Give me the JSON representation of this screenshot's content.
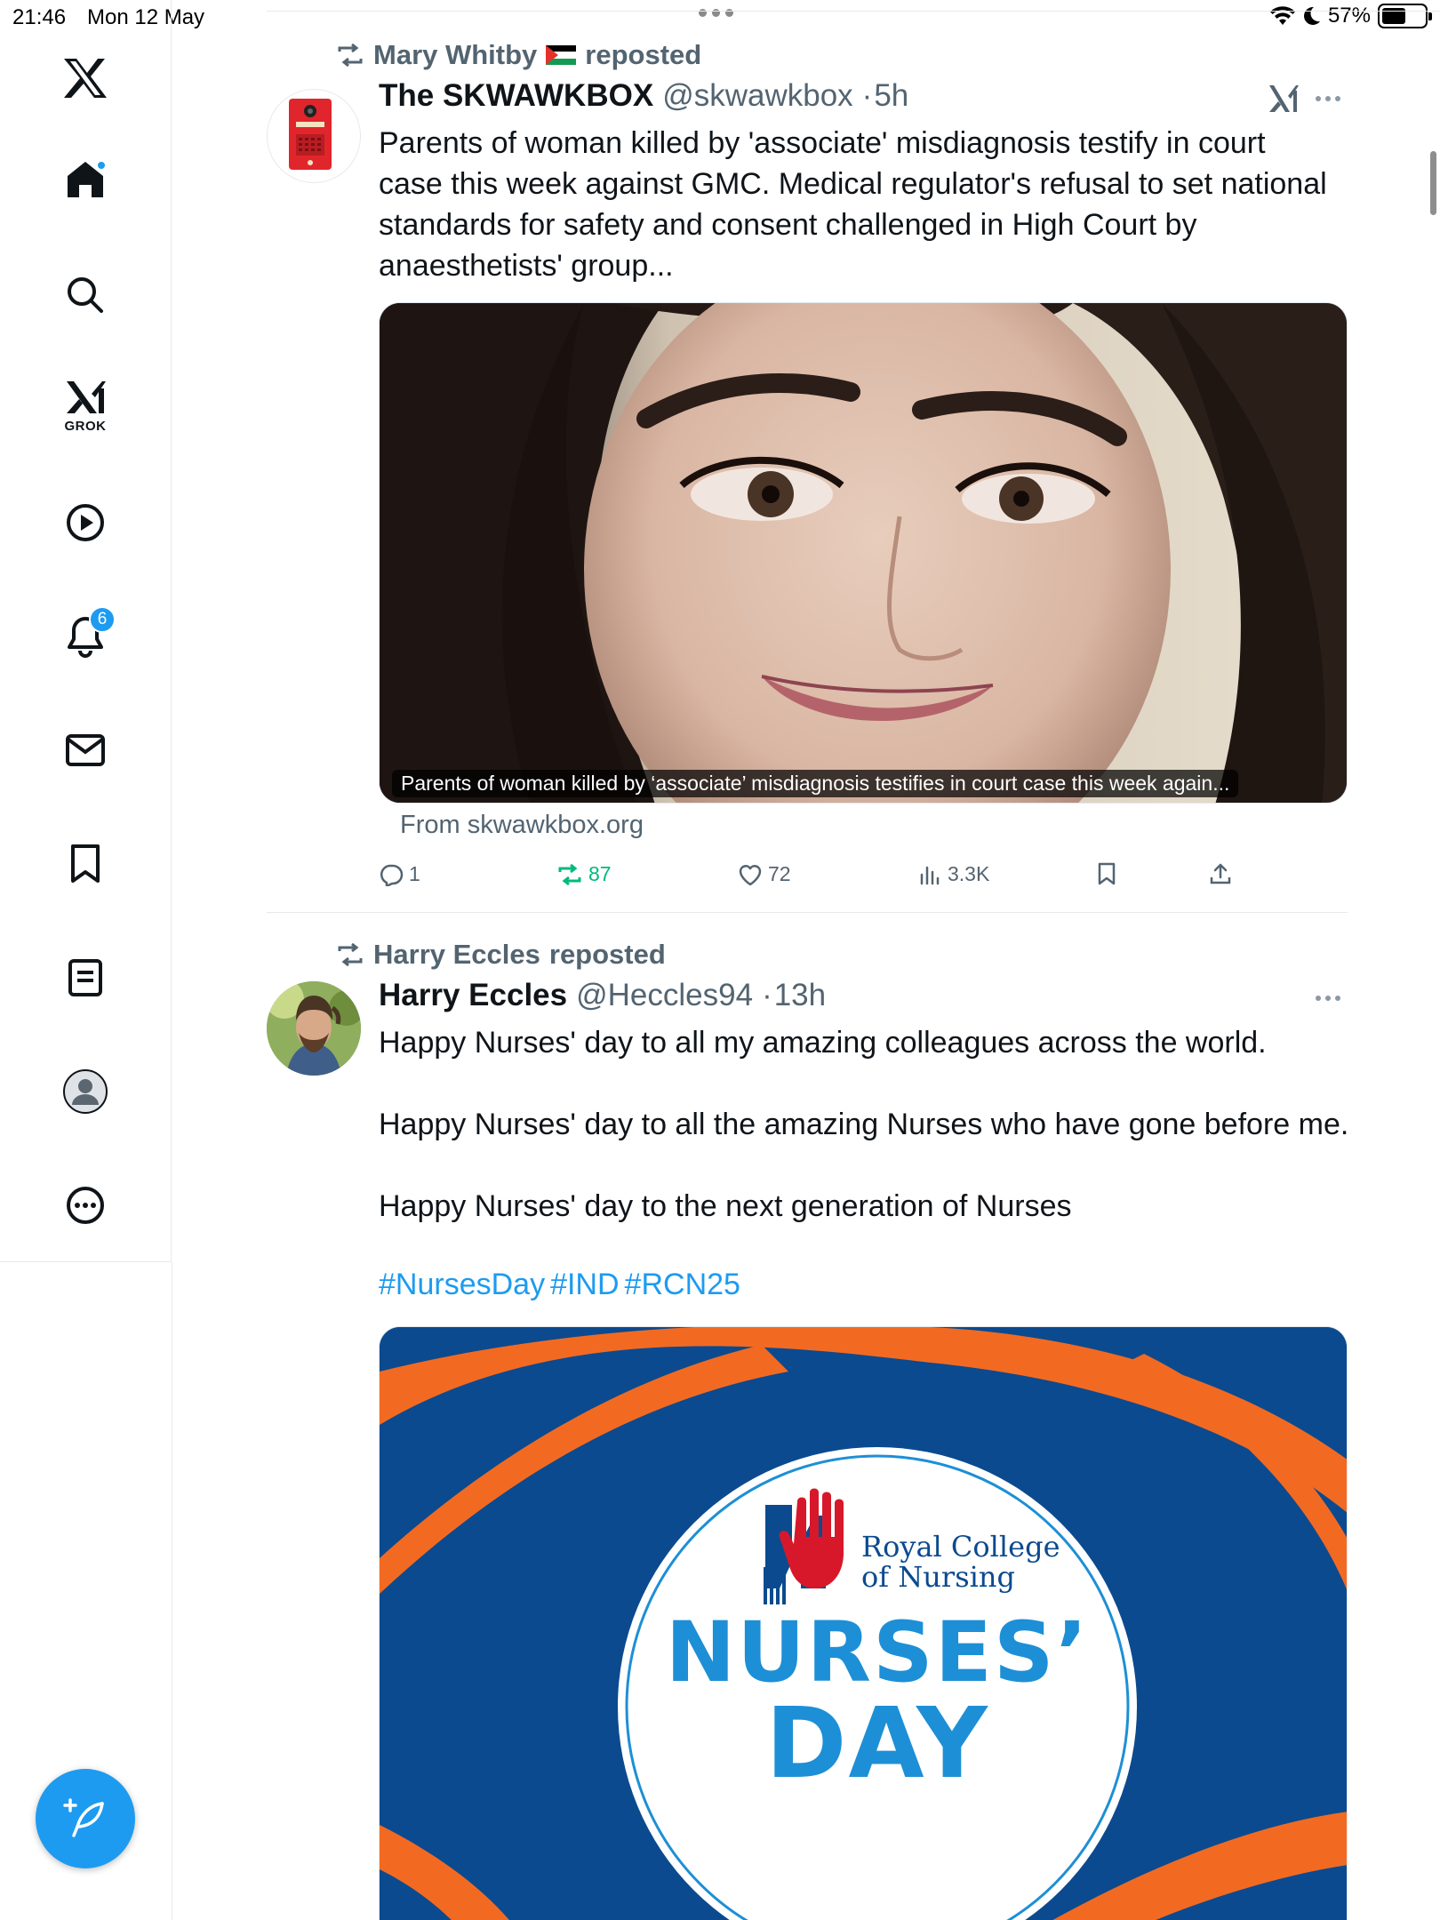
{
  "status_bar": {
    "time": "21:46",
    "date": "Mon 12 May",
    "battery": "57%",
    "battery_level": 0.57
  },
  "sidebar": {
    "items": [
      {
        "name": "home",
        "icon": "home-icon"
      },
      {
        "name": "explore",
        "icon": "search-icon"
      },
      {
        "name": "grok",
        "icon": "grok-icon",
        "label": "GROK"
      },
      {
        "name": "videos",
        "icon": "play-icon"
      },
      {
        "name": "notifications",
        "icon": "bell-icon",
        "badge": "6"
      },
      {
        "name": "messages",
        "icon": "envelope-icon"
      },
      {
        "name": "bookmarks",
        "icon": "bookmark-icon"
      },
      {
        "name": "lists",
        "icon": "list-icon"
      },
      {
        "name": "profile",
        "icon": "profile-icon"
      },
      {
        "name": "more",
        "icon": "more-circle-icon"
      }
    ],
    "compose_icon": "compose-icon"
  },
  "colors": {
    "accent": "#1d9bf0",
    "repost_green": "#00ba7c",
    "muted": "#536471",
    "nhs_orange": "#f26a21",
    "nhs_blue": "#0b4a8f",
    "rcn_blue": "#1d8fd6"
  },
  "tweets": [
    {
      "reposted_by": "Mary Whitby",
      "reposted_label": "reposted",
      "author": "The SKWAWKBOX",
      "handle": "@skwawkbox",
      "time": "5h",
      "text_lines": [
        "Parents of woman killed by 'associate' misdiagnosis testify in court",
        "case this week against GMC. Medical regulator's refusal to set national",
        "standards for safety and consent challenged in High Court by",
        "anaesthetists' group..."
      ],
      "media_caption": "Parents of woman killed by ‘associate’ misdiagnosis testifies in court case this week again...",
      "link_source": "From skwawkbox.org",
      "stats": {
        "replies": "1",
        "reposts": "87",
        "likes": "72",
        "views": "3.3K"
      }
    },
    {
      "reposted_by": "Harry Eccles",
      "reposted_label": "reposted",
      "author": "Harry Eccles",
      "handle": "@Heccles94",
      "time": "13h",
      "text_lines": [
        "Happy Nurses' day to all my amazing colleagues across the world.",
        "Happy Nurses' day to all the amazing Nurses who have gone before me.",
        "Happy Nurses' day to the next generation of Nurses"
      ],
      "hashtags": [
        "#NursesDay",
        "#IND",
        "#RCN25"
      ],
      "image_text": {
        "org_line1": "Royal College",
        "org_line2": "of Nursing",
        "headline1": "NURSES’",
        "headline2": "DAY"
      }
    }
  ]
}
